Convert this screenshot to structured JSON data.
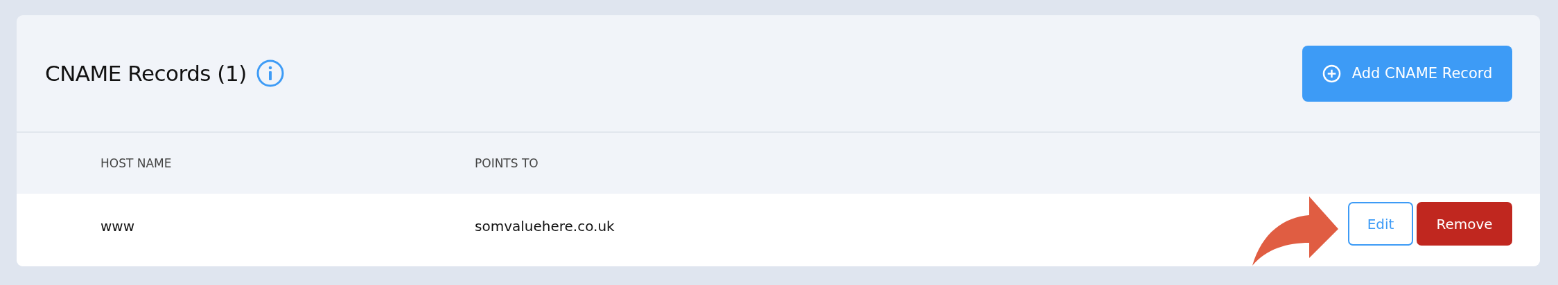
{
  "title": "CNAME Records (1)",
  "add_button": {
    "label": "Add CNAME Record"
  },
  "table": {
    "columns": [
      "HOST NAME",
      "POINTS TO"
    ],
    "rows": [
      {
        "cells": [
          "www",
          "somvaluehere.co.uk"
        ],
        "actions": [
          {
            "kind": "edit",
            "label": "Edit"
          },
          {
            "kind": "remove",
            "label": "Remove"
          }
        ]
      }
    ]
  }
}
